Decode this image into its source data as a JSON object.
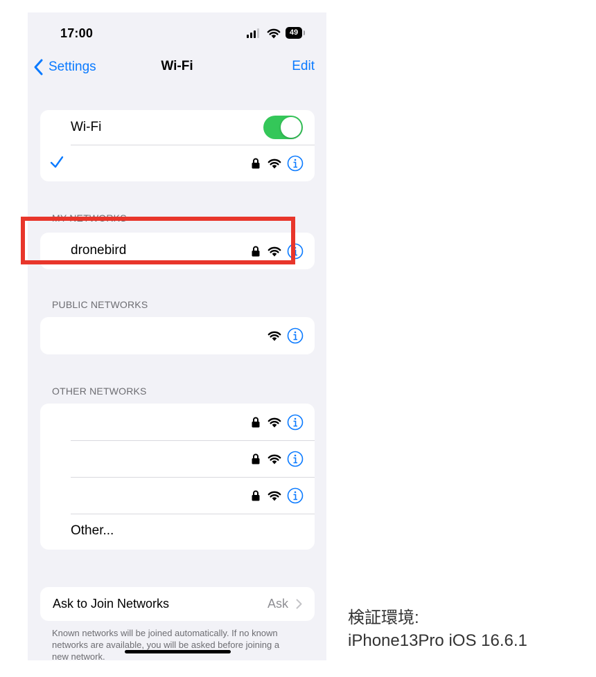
{
  "status_bar": {
    "time": "17:00",
    "battery": "49"
  },
  "nav": {
    "back_label": "Settings",
    "title": "Wi-Fi",
    "edit_label": "Edit"
  },
  "wifi_section": {
    "toggle_label": "Wi-Fi",
    "toggle_on": true
  },
  "my_networks": {
    "header": "MY NETWORKS",
    "items": [
      {
        "name": "dronebird"
      }
    ]
  },
  "public_networks": {
    "header": "PUBLIC NETWORKS"
  },
  "other_networks": {
    "header": "OTHER NETWORKS",
    "other_label": "Other..."
  },
  "ask_to_join": {
    "label": "Ask to Join Networks",
    "value": "Ask",
    "footer": "Known networks will be joined automatically. If no known networks are available, you will be asked before joining a new network."
  },
  "caption": {
    "line1": "検証環境:",
    "line2": "iPhone13Pro iOS 16.6.1"
  },
  "colors": {
    "accent": "#0a7aff",
    "toggle_on": "#34c759",
    "highlight": "#e8362b"
  },
  "icons": [
    "back-chevron-icon",
    "checkmark-icon",
    "lock-icon",
    "wifi-icon",
    "info-icon",
    "chevron-right-icon"
  ]
}
